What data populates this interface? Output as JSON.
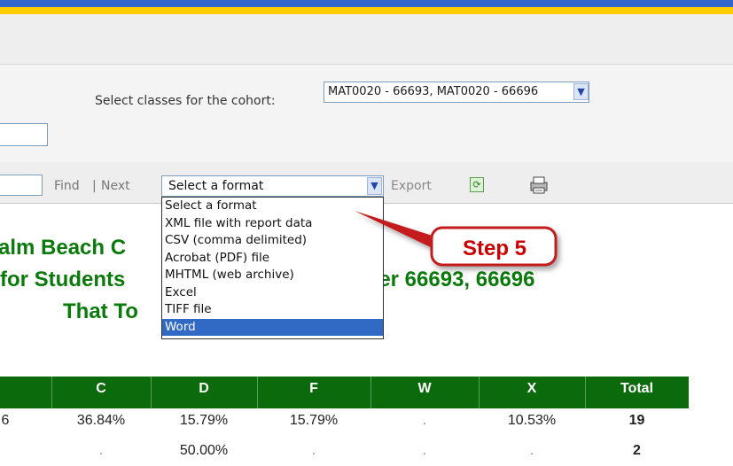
{
  "params": {
    "cohort_label": "Select classes for the cohort:",
    "cohort_value": "MAT0020 - 66693, MAT0020 - 66696"
  },
  "toolbar": {
    "find": "Find",
    "separator": "|",
    "next": "Next",
    "format_value": "Select a format",
    "export": "Export",
    "icons": [
      "refresh-icon",
      "print-icon"
    ]
  },
  "format_options": [
    "Select a format",
    "XML file with report data",
    "CSV (comma delimited)",
    "Acrobat (PDF) file",
    "MHTML (web archive)",
    "Excel",
    "TIFF file",
    "Word"
  ],
  "selected_option": "Word",
  "callout": {
    "label": "Step 5"
  },
  "heading": {
    "line1": "alm Beach C",
    "line2": "for Students",
    "line2_tail": "nber 66693, 66696",
    "line3": "That To"
  },
  "table": {
    "headers": [
      "C",
      "D",
      "F",
      "W",
      "X",
      "Total"
    ],
    "rows": [
      {
        "lead": "6",
        "cells": [
          "36.84%",
          "15.79%",
          "15.79%",
          ".",
          "10.53%",
          "19"
        ]
      },
      {
        "lead": "",
        "cells": [
          ".",
          "50.00%",
          ".",
          ".",
          ".",
          "2"
        ]
      }
    ]
  },
  "colors": {
    "brand_blue": "#3366cc",
    "brand_yellow": "#ffcc00",
    "heading_green": "#0a7a0a",
    "table_header": "#0b6a0b",
    "callout_red": "#cc0000",
    "selection": "#316ac5"
  }
}
